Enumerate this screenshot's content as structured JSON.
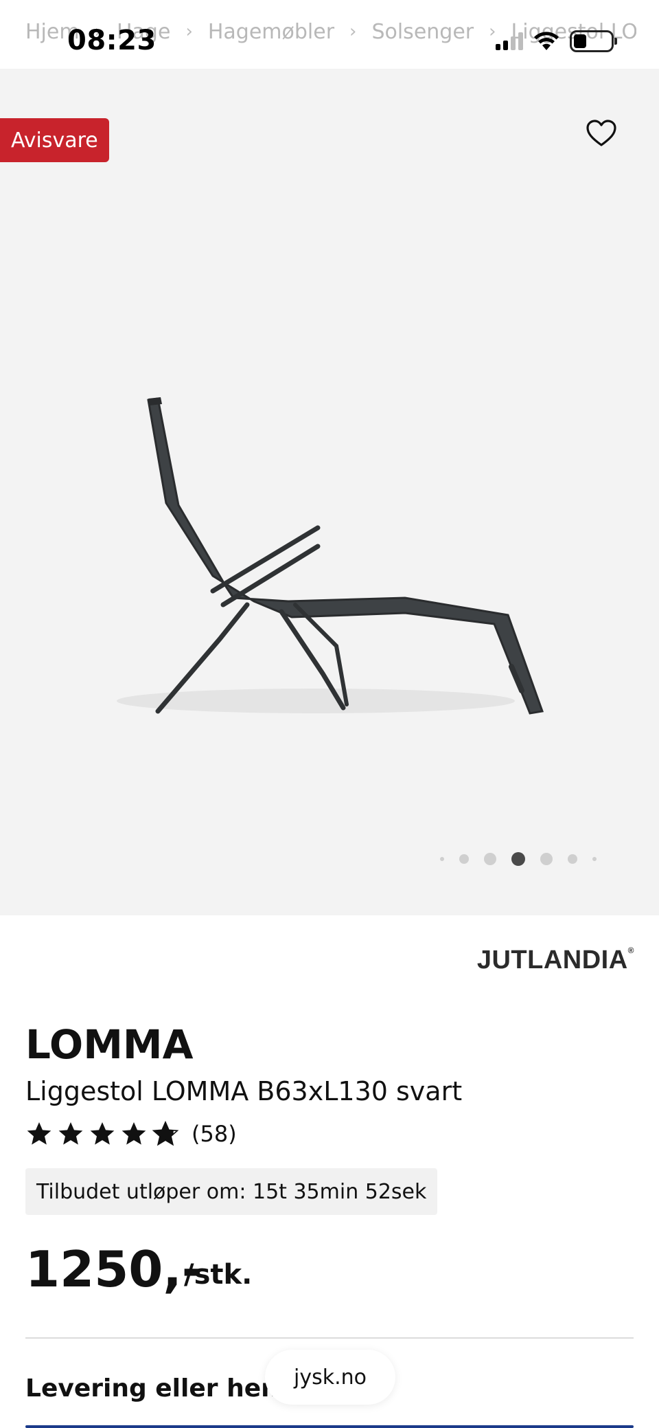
{
  "status_bar": {
    "time": "08:23"
  },
  "breadcrumb": {
    "items": [
      "Hjem",
      "Hage",
      "Hagemøbler",
      "Solsenger",
      "Liggestol LOMM"
    ],
    "separator": "›"
  },
  "hero": {
    "badge": "Avisvare",
    "badge_color": "#c8232c",
    "favorite_icon": "heart-outline-icon",
    "carousel": {
      "total": 7,
      "active_index": 3
    }
  },
  "product": {
    "brand": "JUTLANDIA",
    "name": "LOMMA",
    "subtitle": "Liggestol LOMMA B63xL130 svart",
    "rating": 4.8,
    "rating_count": "(58)",
    "offer_text": "Tilbudet utløper om: 15t 35min 52sek",
    "price": "1250,-",
    "unit": "/stk."
  },
  "delivery_heading": "Levering eller henting",
  "browser": {
    "url": "jysk.no"
  }
}
